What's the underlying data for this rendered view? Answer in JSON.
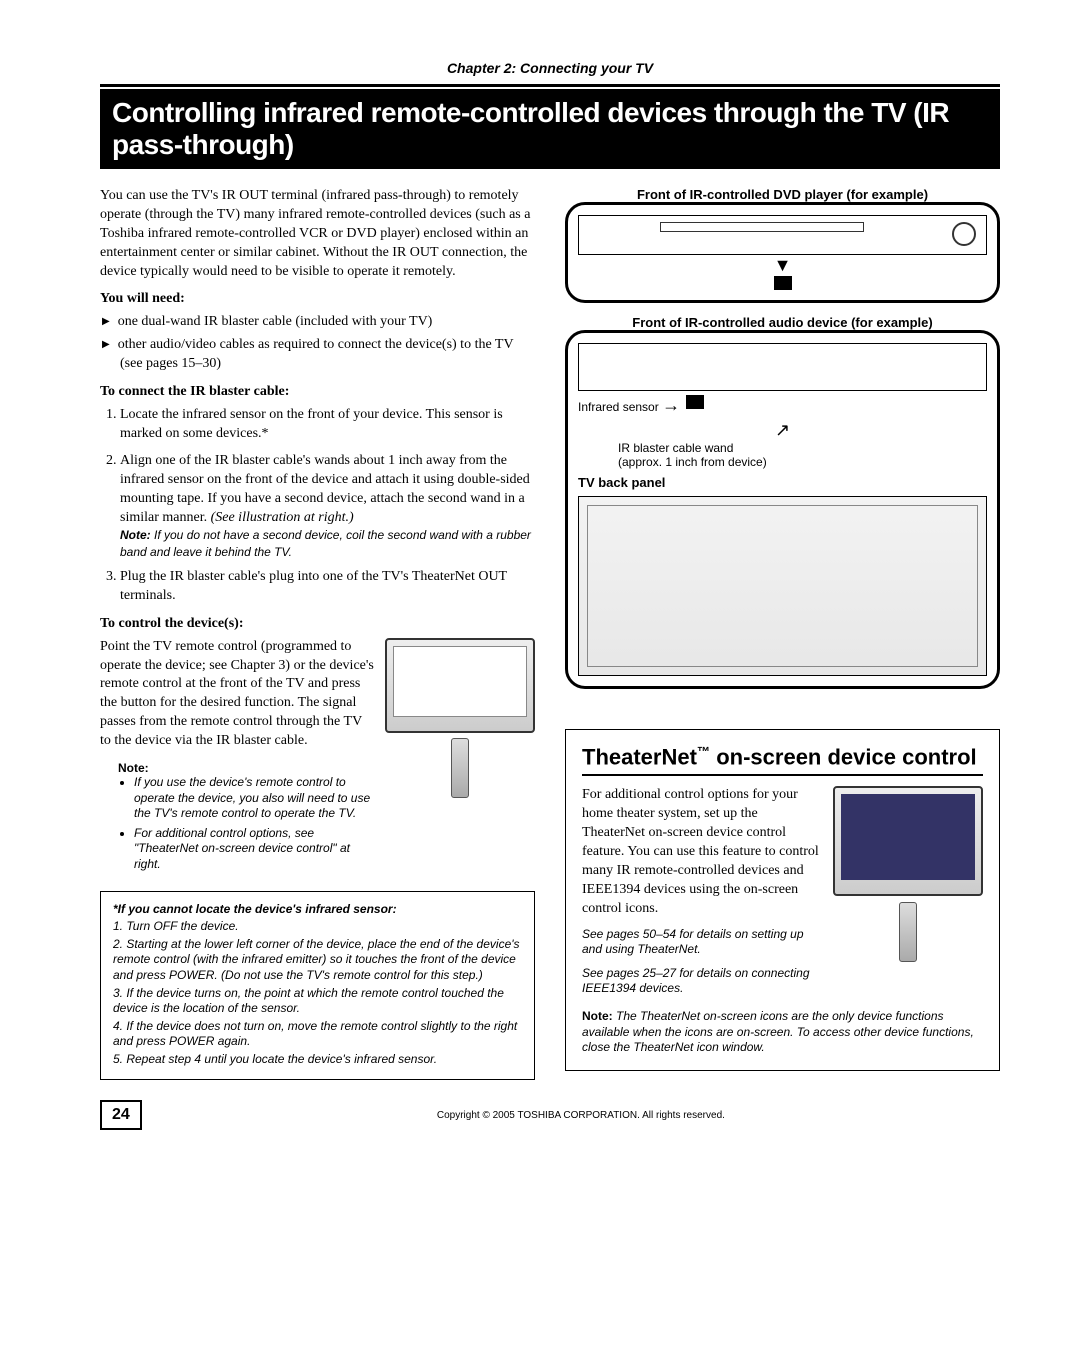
{
  "chapter": "Chapter 2: Connecting your TV",
  "title": "Controlling infrared remote-controlled devices through the TV (IR pass-through)",
  "intro": "You can use the TV's IR OUT terminal (infrared pass-through) to remotely operate (through the TV) many infrared remote-controlled devices (such as a Toshiba infrared remote-controlled VCR or DVD player) enclosed within an entertainment center or similar cabinet. Without the IR OUT connection, the device typically would need to be visible to operate it remotely.",
  "need_head": "You will need:",
  "need_items": [
    "one dual-wand IR blaster cable (included with your TV)",
    "other audio/video cables as required to connect the device(s) to the TV (see pages 15–30)"
  ],
  "connect_head": "To connect the IR blaster cable:",
  "connect_steps": {
    "s1": "Locate the infrared sensor on the front of your device. This sensor is marked on some devices.*",
    "s2": "Align one of the IR blaster cable's wands about 1 inch away from the infrared sensor on the front of the device and attach it using double-sided mounting tape. If you have a second device, attach the second wand in a similar manner. ",
    "s2_suffix": "(See illustration at right.)",
    "s2_note_word": "Note:",
    "s2_note": " If you do not have a second device, coil the second wand with a rubber band and leave it behind the TV.",
    "s3": "Plug the IR blaster cable's plug into one of the TV's TheaterNet OUT terminals."
  },
  "control_head": "To control the device(s):",
  "control_text": "Point the TV remote control (programmed to operate the device; see Chapter 3) or the device's remote control at the front of the TV and press the button for the desired function. The signal passes from the remote control through the TV to the device via the IR blaster cable.",
  "control_note_word": "Note:",
  "control_notes": [
    "If you use the device's remote control to operate the device, you also will need to use the TV's remote control to operate the TV.",
    "For additional control options, see \"TheaterNet on-screen device control\" at right."
  ],
  "locate": {
    "title": "*If you cannot locate the device's infrared sensor:",
    "steps": [
      "1. Turn OFF the device.",
      "2. Starting at the lower left corner of the device, place the end of the device's remote control (with the infrared emitter) so it touches the front of the device and press POWER. (Do not use the TV's remote control for this step.)",
      "3. If the device turns on, the point at which the remote control touched the device is the location of the sensor.",
      "4. If the device does not turn on, move the remote control slightly to the right and press POWER again.",
      "5. Repeat step 4 until you locate the device's infrared sensor."
    ]
  },
  "diagram": {
    "dvd_label": "Front of IR-controlled DVD player (for example)",
    "audio_label": "Front of IR-controlled audio device (for example)",
    "infrared_sensor": "Infrared sensor",
    "ir_wand": "IR blaster cable wand",
    "ir_wand_sub": "(approx. 1 inch from device)",
    "back_panel": "TV back panel"
  },
  "theaternet": {
    "title_pre": "TheaterNet",
    "title_suf": " on-screen device control",
    "body": "For additional control options for your home theater system, set up the TheaterNet on-screen device control feature. You can use this feature to control many IR remote-controlled devices and IEEE1394 devices using the on-screen control icons.",
    "see1": "See pages 50–54 for details on setting up and using TheaterNet.",
    "see2": "See pages 25–27 for details on connecting IEEE1394 devices.",
    "note_word": "Note:",
    "note": " The TheaterNet on-screen icons are the only device functions available when the icons are on-screen. To access other device functions, close the TheaterNet icon window."
  },
  "page_number": "24",
  "copyright": "Copyright © 2005 TOSHIBA CORPORATION. All rights reserved."
}
